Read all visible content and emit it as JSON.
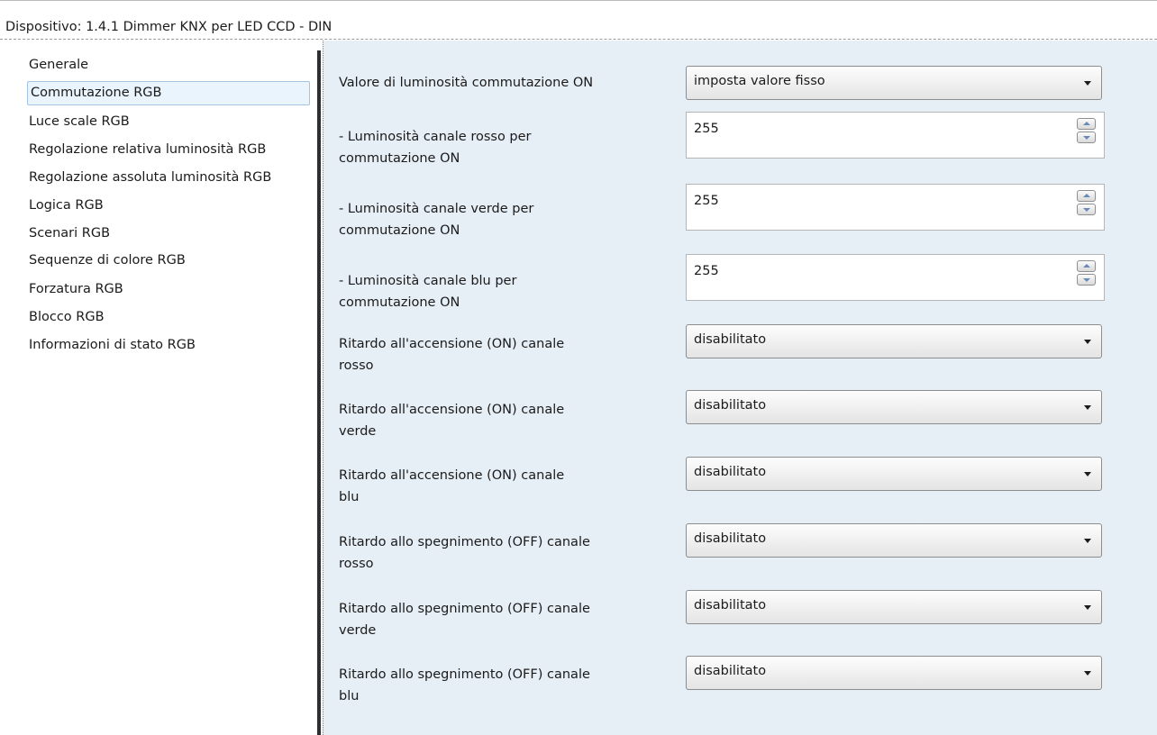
{
  "header": {
    "title": "Dispositivo: 1.4.1  Dimmer KNX per LED CCD - DIN"
  },
  "sidebar": {
    "items": [
      {
        "label": "Generale"
      },
      {
        "label": "Commutazione RGB"
      },
      {
        "label": "Luce scale RGB"
      },
      {
        "label": "Regolazione relativa luminosità RGB"
      },
      {
        "label": "Regolazione assoluta luminosità RGB"
      },
      {
        "label": "Logica RGB"
      },
      {
        "label": "Scenari RGB"
      },
      {
        "label": "Sequenze di colore RGB"
      },
      {
        "label": "Forzatura RGB"
      },
      {
        "label": "Blocco RGB"
      },
      {
        "label": "Informazioni di stato RGB"
      }
    ],
    "selected": "Commutazione RGB"
  },
  "params": [
    {
      "label_line1": "Valore di luminosità commutazione ON",
      "label_line2": "",
      "type": "dropdown",
      "value": "imposta valore fisso"
    },
    {
      "label_line1": "- Luminosità canale rosso per",
      "label_line2": "commutazione ON",
      "type": "spin",
      "value": "255"
    },
    {
      "label_line1": "- Luminosità canale verde per",
      "label_line2": "commutazione ON",
      "type": "spin",
      "value": "255"
    },
    {
      "label_line1": "- Luminosità canale blu per",
      "label_line2": "commutazione ON",
      "type": "spin",
      "value": "255"
    },
    {
      "label_line1": "Ritardo all'accensione (ON) canale",
      "label_line2": "rosso",
      "type": "dropdown",
      "value": "disabilitato"
    },
    {
      "label_line1": "Ritardo all'accensione (ON) canale",
      "label_line2": "verde",
      "type": "dropdown",
      "value": "disabilitato"
    },
    {
      "label_line1": "Ritardo all'accensione (ON) canale",
      "label_line2": "blu",
      "type": "dropdown",
      "value": "disabilitato"
    },
    {
      "label_line1": "Ritardo allo spegnimento (OFF) canale",
      "label_line2": "rosso",
      "type": "dropdown",
      "value": "disabilitato"
    },
    {
      "label_line1": "Ritardo allo spegnimento (OFF) canale",
      "label_line2": "verde",
      "type": "dropdown",
      "value": "disabilitato"
    },
    {
      "label_line1": "Ritardo allo spegnimento (OFF) canale",
      "label_line2": "blu",
      "type": "dropdown",
      "value": "disabilitato"
    }
  ],
  "icons": {
    "dropdown": "chevron-down-icon",
    "spin_up": "spin-up-icon",
    "spin_down": "spin-down-icon"
  },
  "colors": {
    "content_bg": "#e6eef6",
    "selection_bg": "#eaf4fc",
    "selection_border": "#a4c4e2"
  }
}
